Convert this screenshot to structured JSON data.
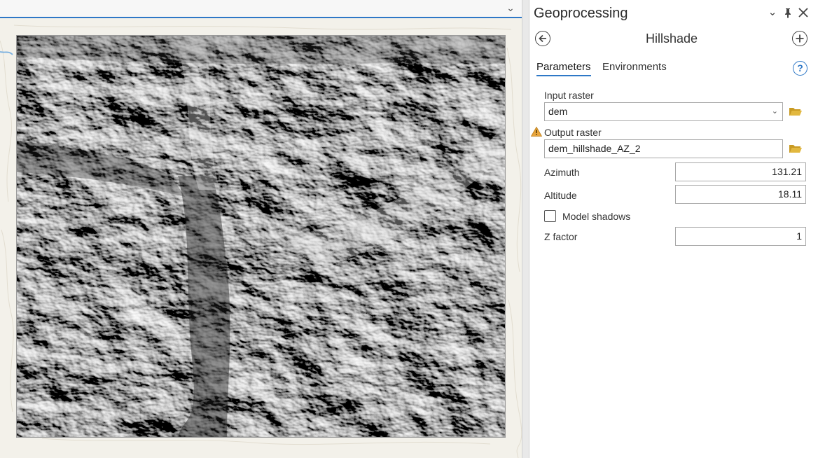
{
  "pane": {
    "title": "Geoprocessing",
    "tool_title": "Hillshade",
    "controls": {
      "menu": "chevron-down-icon",
      "pin": "pin-icon",
      "close": "close-icon"
    }
  },
  "tabs": [
    {
      "label": "Parameters",
      "active": true
    },
    {
      "label": "Environments",
      "active": false
    }
  ],
  "params": {
    "input_raster_label": "Input raster",
    "input_raster_value": "dem",
    "output_raster_label": "Output raster",
    "output_raster_value": "dem_hillshade_AZ_2",
    "azimuth_label": "Azimuth",
    "azimuth_value": "131.21",
    "altitude_label": "Altitude",
    "altitude_value": "18.11",
    "model_shadows_label": "Model shadows",
    "model_shadows_checked": false,
    "z_factor_label": "Z factor",
    "z_factor_value": "1"
  },
  "colors": {
    "accent": "#2e78c7",
    "warning": "#e8a53c",
    "folder": "#e2b83f"
  }
}
